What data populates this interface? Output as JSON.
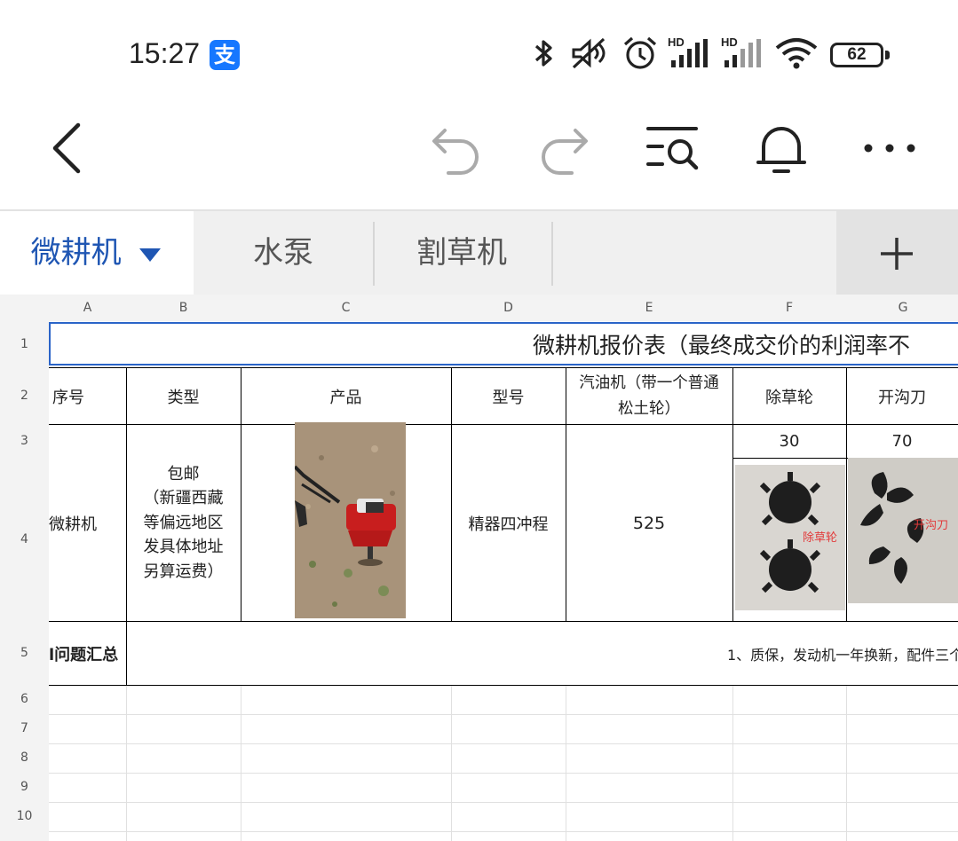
{
  "status_bar": {
    "time": "15:27",
    "alipay_icon_text": "支",
    "hd_label": "HD",
    "battery_level": "62",
    "icons": [
      "bluetooth-icon",
      "mute-icon",
      "alarm-icon",
      "signal-icon",
      "wifi-icon",
      "battery-icon"
    ]
  },
  "toolbar": {
    "icons": [
      "back-icon",
      "undo-icon",
      "redo-icon",
      "search-list-icon",
      "bell-icon",
      "more-icon"
    ]
  },
  "sheet_tabs": [
    {
      "label": "微耕机",
      "active": true
    },
    {
      "label": "水泵",
      "active": false
    },
    {
      "label": "割草机",
      "active": false
    }
  ],
  "add_sheet_label": "+",
  "accent_color": "#1f56b3",
  "column_headers": [
    "A",
    "B",
    "C",
    "D",
    "E",
    "F",
    "G"
  ],
  "row_headers": [
    "1",
    "2",
    "3",
    "4",
    "5",
    "6",
    "7",
    "8",
    "9",
    "10"
  ],
  "sheet": {
    "title": "微耕机报价表（最终成交价的利润率不",
    "header_row": {
      "seq": "序号",
      "type": "类型",
      "product": "产品",
      "model": "型号",
      "engine_line1": "汽油机（带一个普通",
      "engine_line2": "松土轮）",
      "weeder": "除草轮",
      "trencher": "开沟刀"
    },
    "price_row": {
      "weeder_price": "30",
      "trencher_price": "70"
    },
    "item_row": {
      "seq": "微耕机",
      "type_lines": [
        "包邮",
        "（新疆西藏",
        "等偏远地区",
        "发具体地址",
        "另算运费）"
      ],
      "model": "精器四冲程",
      "engine_price": "525",
      "weeder_photo_label": "除草轮",
      "trencher_photo_label": "开沟刀"
    },
    "summary_row": {
      "label": "l问题汇总",
      "text": "1、质保，发动机一年换新，配件三个"
    }
  }
}
